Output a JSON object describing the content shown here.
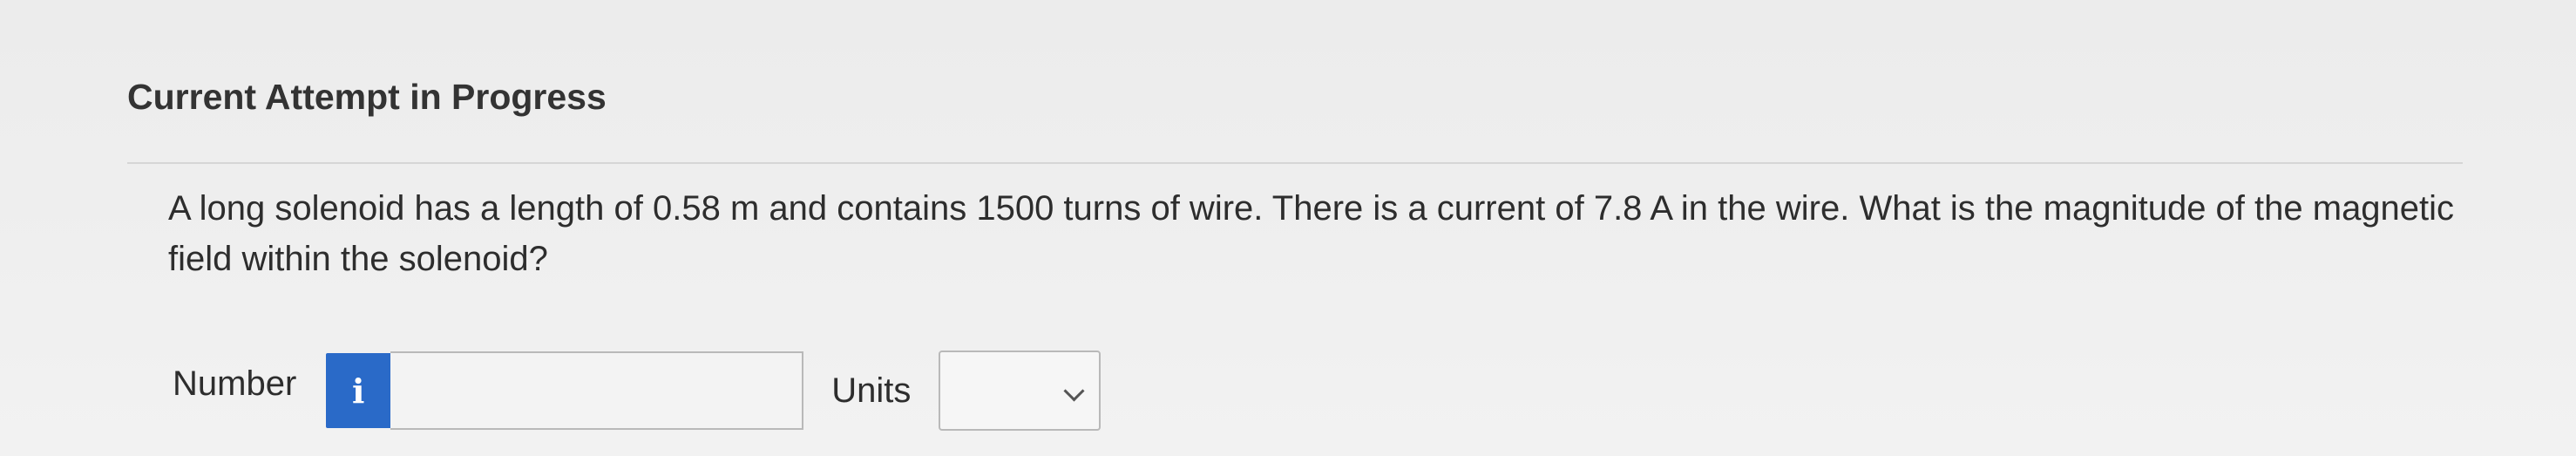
{
  "heading": "Current Attempt in Progress",
  "question": "A long solenoid has a length of 0.58 m and contains 1500 turns of wire. There is a current of 7.8 A in the wire. What is the magnitude of the magnetic field within the solenoid?",
  "answer": {
    "number_label": "Number",
    "info_icon": "i",
    "number_value": "",
    "units_label": "Units",
    "units_selected": ""
  },
  "colors": {
    "info_button": "#2a6ac8",
    "background": "#eeeeee"
  }
}
